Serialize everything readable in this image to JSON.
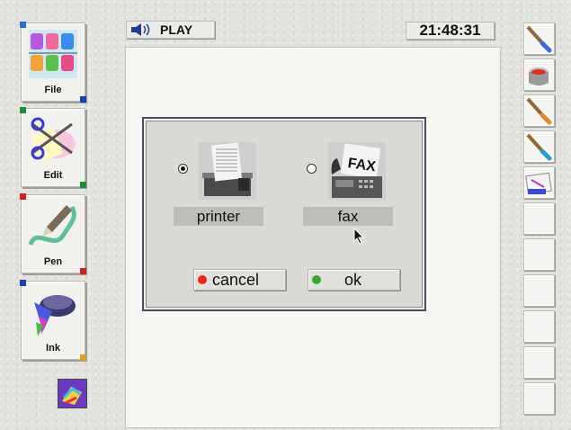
{
  "tools": [
    {
      "label": "File",
      "icon": "file-icon"
    },
    {
      "label": "Edit",
      "icon": "edit-icon"
    },
    {
      "label": "Pen",
      "icon": "pen-icon"
    },
    {
      "label": "Ink",
      "icon": "ink-icon"
    }
  ],
  "topbar": {
    "play_label": "PLAY",
    "clock": "21:48:31"
  },
  "dialog": {
    "options": [
      {
        "label": "printer",
        "selected": true
      },
      {
        "label": "fax",
        "selected": false
      }
    ],
    "cancel_label": "cancel",
    "ok_label": "ok",
    "fax_image_text": "FAX"
  },
  "colors": {
    "cancel_dot": "#e8261a",
    "ok_dot": "#3fa82c",
    "dialog_border": "#4a4a58"
  }
}
